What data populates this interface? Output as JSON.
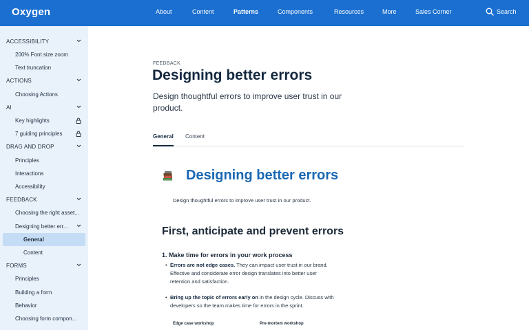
{
  "header": {
    "logo": "Oxygen",
    "nav": [
      "About",
      "Content",
      "Patterns",
      "Components",
      "Resources",
      "More",
      "Sales Corner"
    ],
    "active_nav": "Patterns",
    "search_label": "Search",
    "bar_color": "#1a6fd0"
  },
  "sidebar": {
    "items": [
      {
        "label": "ACCESSIBILITY",
        "kind": "section",
        "icon": "chevron-down-icon"
      },
      {
        "label": "200% Font size zoom",
        "kind": "child"
      },
      {
        "label": "Text truncation",
        "kind": "child"
      },
      {
        "label": "ACTIONS",
        "kind": "section",
        "icon": "chevron-down-icon"
      },
      {
        "label": "Choosing Actions",
        "kind": "child"
      },
      {
        "label": "AI",
        "kind": "section",
        "icon": "chevron-down-icon"
      },
      {
        "label": "Key highlights",
        "kind": "child",
        "icon": "lock-icon"
      },
      {
        "label": "7 guiding principles",
        "kind": "child",
        "icon": "lock-icon"
      },
      {
        "label": "DRAG AND DROP",
        "kind": "section",
        "icon": "chevron-down-icon"
      },
      {
        "label": "Principles",
        "kind": "child"
      },
      {
        "label": "Interactions",
        "kind": "child"
      },
      {
        "label": "Accessibility",
        "kind": "child"
      },
      {
        "label": "FEEDBACK",
        "kind": "section",
        "icon": "chevron-down-icon"
      },
      {
        "label": "Choosing the right asset...",
        "kind": "child"
      },
      {
        "label": "Designing better err...",
        "kind": "child",
        "icon": "chevron-down-icon"
      },
      {
        "label": "General",
        "kind": "grand",
        "selected": true
      },
      {
        "label": "Content",
        "kind": "grand"
      },
      {
        "label": "FORMS",
        "kind": "section",
        "icon": "chevron-down-icon"
      },
      {
        "label": "Principles",
        "kind": "child"
      },
      {
        "label": "Building a form",
        "kind": "child"
      },
      {
        "label": "Behavior",
        "kind": "child"
      },
      {
        "label": "Choosing form compon...",
        "kind": "child"
      }
    ],
    "background": "#e9f2fb",
    "selected_color": "#c5dcf5"
  },
  "page": {
    "eyebrow": "FEEDBACK",
    "title": "Designing better errors",
    "subtitle": "Design thoughtful errors to improve user trust in our product.",
    "tabs": [
      "General",
      "Content"
    ],
    "active_tab": "General"
  },
  "article": {
    "icon": "books-icon",
    "heading": "Designing better errors",
    "heading_color": "#1a68b4",
    "intro": "Design thoughtful errors to improve user trust in our product.",
    "section_heading": "First, anticipate and prevent errors",
    "step_heading": "1. Make time for errors in your work process",
    "bullets": [
      {
        "bold": "Errors are not edge cases.",
        "text": " They can impact user trust in our brand. Effective and considerate error design translates into better user retention and satisfaction."
      },
      {
        "bold": "Bring up the topic of errors early on",
        "text": " in the design cycle. Discuss with developers so the team makes time for errors in the sprint."
      }
    ],
    "captions": [
      "Edge case workshop",
      "Pre-mortem workshop"
    ]
  }
}
